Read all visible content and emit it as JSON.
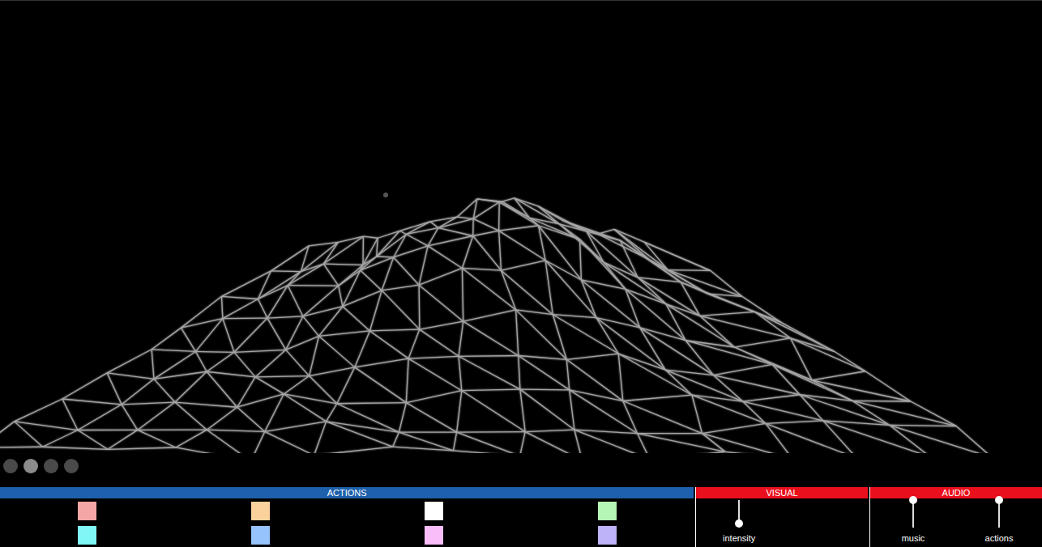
{
  "view_pages": [
    {
      "selected": false
    },
    {
      "selected": true
    },
    {
      "selected": false
    },
    {
      "selected": false
    }
  ],
  "sections": {
    "actions": {
      "title": "ACTIONS",
      "color": "#1e60ab",
      "swatches": [
        {
          "color": "#f4a6a6"
        },
        {
          "color": "#fbd29b"
        },
        {
          "color": "#ffffff"
        },
        {
          "color": "#b5f5b5"
        },
        {
          "color": "#80f6f6"
        },
        {
          "color": "#96c3fb"
        },
        {
          "color": "#f9bdf9"
        },
        {
          "color": "#beb3f9"
        }
      ]
    },
    "visual": {
      "title": "VISUAL",
      "color": "#ea0f1c",
      "sliders": [
        {
          "label": "intensity",
          "level": 0.15
        }
      ]
    },
    "audio": {
      "title": "AUDIO",
      "color": "#ea0f1c",
      "sliders": [
        {
          "label": "music",
          "level": 1
        },
        {
          "label": "actions",
          "level": 1
        }
      ]
    }
  }
}
